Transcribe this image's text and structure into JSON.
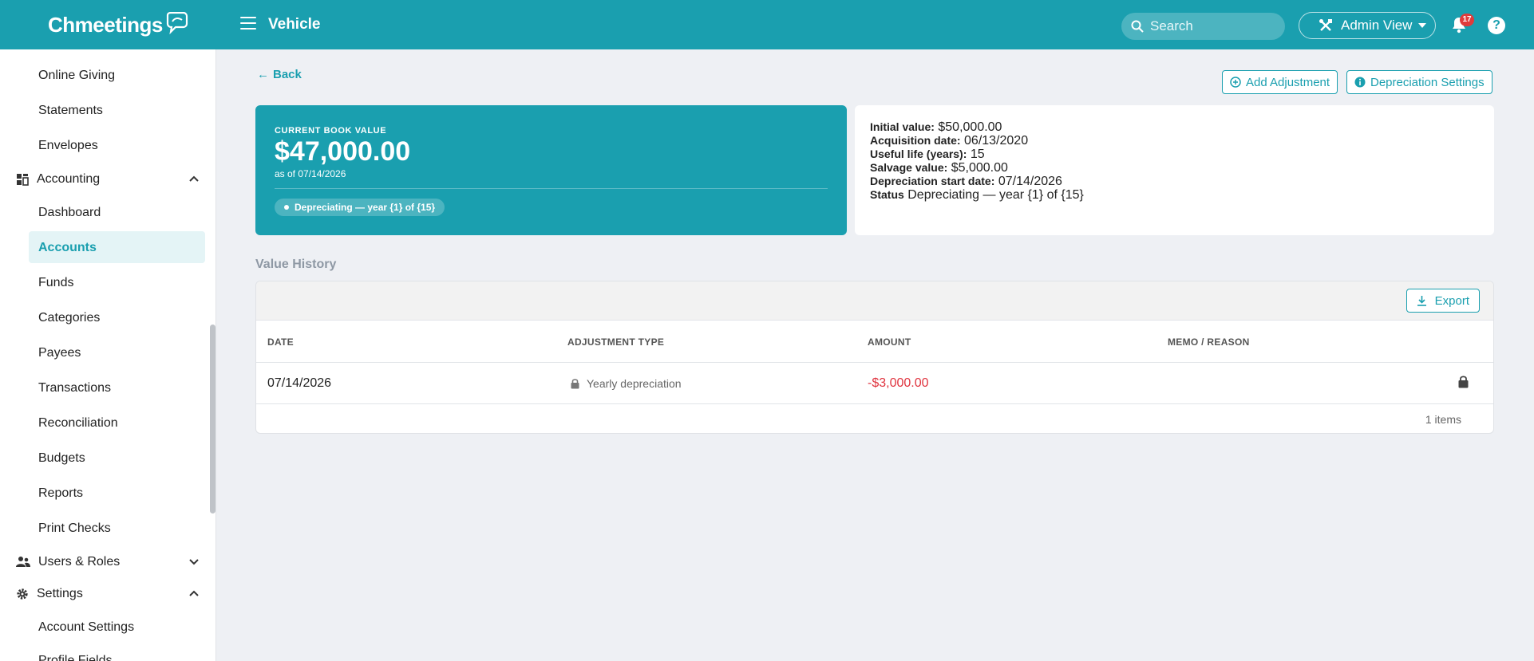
{
  "app": {
    "logo": "Chmeetings",
    "page_title": "Vehicle"
  },
  "topbar": {
    "search_placeholder": "Search",
    "admin_view": "Admin View",
    "notifications_count": "17",
    "help": "?"
  },
  "sidebar": {
    "items_top": [
      "Online Giving",
      "Statements",
      "Envelopes"
    ],
    "accounting": {
      "label": "Accounting",
      "items": [
        "Dashboard",
        "Accounts",
        "Funds",
        "Categories",
        "Payees",
        "Transactions",
        "Reconciliation",
        "Budgets",
        "Reports",
        "Print Checks"
      ],
      "active": "Accounts"
    },
    "users_roles": "Users & Roles",
    "settings": {
      "label": "Settings",
      "items": [
        "Account Settings",
        "Profile Fields"
      ]
    }
  },
  "main": {
    "back": "Back",
    "add_adjustment": "Add Adjustment",
    "depreciation_settings": "Depreciation Settings",
    "book_value": {
      "caption": "CURRENT BOOK VALUE",
      "amount": "$47,000.00",
      "as_of": "as of 07/14/2026",
      "status_pill": "Depreciating — year {1} of {15}"
    },
    "details": [
      {
        "label": "Initial value:",
        "value": "$50,000.00"
      },
      {
        "label": "Acquisition date:",
        "value": "06/13/2020"
      },
      {
        "label": "Useful life (years):",
        "value": "15"
      },
      {
        "label": "Salvage value:",
        "value": "$5,000.00"
      },
      {
        "label": "Depreciation start date:",
        "value": "07/14/2026"
      },
      {
        "label": "Status",
        "value": "Depreciating — year {1} of {15}"
      }
    ],
    "value_history": {
      "title": "Value History",
      "export": "Export",
      "columns": [
        "DATE",
        "ADJUSTMENT TYPE",
        "AMOUNT",
        "MEMO / REASON"
      ],
      "rows": [
        {
          "date": "07/14/2026",
          "type": "Yearly depreciation",
          "amount": "-$3,000.00",
          "memo": ""
        }
      ],
      "footer": "1 items"
    }
  },
  "colors": {
    "brand": "#1a9faf",
    "negative": "#e0343f",
    "badge": "#e03b3b"
  }
}
